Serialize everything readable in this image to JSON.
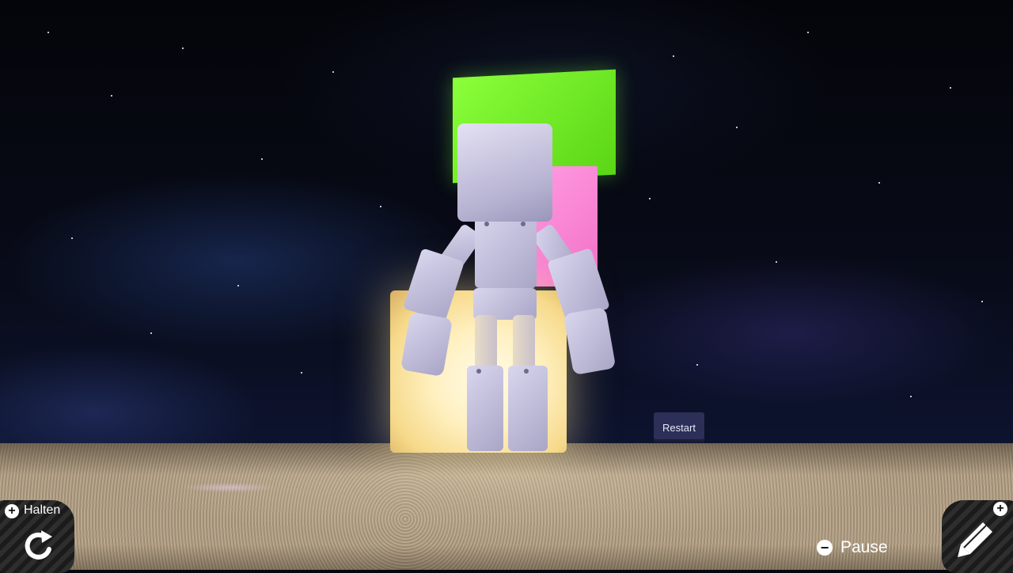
{
  "world": {
    "restart_label": "Restart",
    "cube_colors": {
      "green": "#6fe825",
      "pink": "#f47fce",
      "glow": "#fff2c8"
    }
  },
  "hud": {
    "hold": {
      "label": "Halten",
      "icon": "rotate-arrow-icon"
    },
    "pause": {
      "label": "Pause",
      "icon": "minus-circle-icon"
    },
    "edit": {
      "icon": "pencil-icon"
    }
  }
}
